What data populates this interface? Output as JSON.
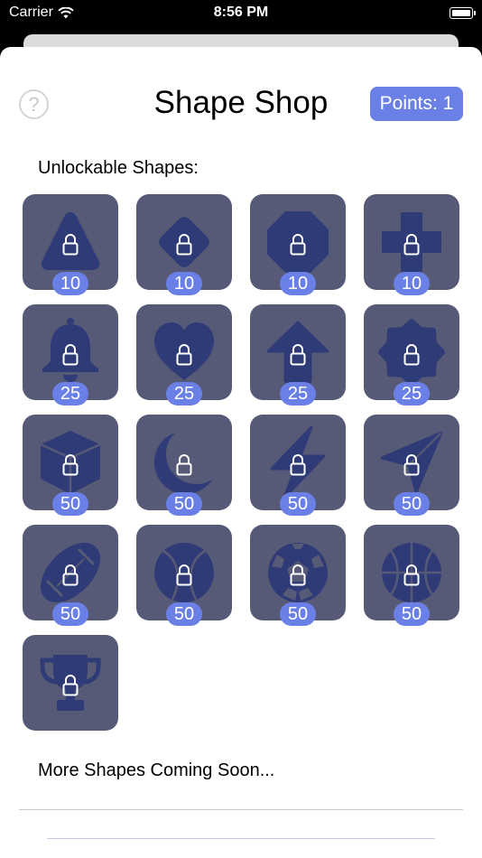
{
  "status_bar": {
    "carrier": "Carrier",
    "time": "8:56 PM"
  },
  "header": {
    "title": "Shape Shop",
    "points": "Points: 1",
    "help": "?"
  },
  "section_heading": "Unlockable Shapes:",
  "shapes": [
    {
      "shape": "triangle-icon",
      "price": "10"
    },
    {
      "shape": "diamond-icon",
      "price": "10"
    },
    {
      "shape": "octagon-icon",
      "price": "10"
    },
    {
      "shape": "cross-icon",
      "price": "10"
    },
    {
      "shape": "bell-icon",
      "price": "25"
    },
    {
      "shape": "heart-icon",
      "price": "25"
    },
    {
      "shape": "arrow-up-icon",
      "price": "25"
    },
    {
      "shape": "seal-icon",
      "price": "25"
    },
    {
      "shape": "cube-icon",
      "price": "50"
    },
    {
      "shape": "moon-icon",
      "price": "50"
    },
    {
      "shape": "bolt-icon",
      "price": "50"
    },
    {
      "shape": "paperplane-icon",
      "price": "50"
    },
    {
      "shape": "football-icon",
      "price": "50"
    },
    {
      "shape": "baseball-icon",
      "price": "50"
    },
    {
      "shape": "soccer-ball-icon",
      "price": "50"
    },
    {
      "shape": "basketball-icon",
      "price": "50"
    },
    {
      "shape": "trophy-icon",
      "price": ""
    }
  ],
  "footer_text": "More Shapes Coming Soon...",
  "colors": {
    "tile": "#575a76",
    "shape": "#2e3b76",
    "accent": "#6b80e6"
  }
}
